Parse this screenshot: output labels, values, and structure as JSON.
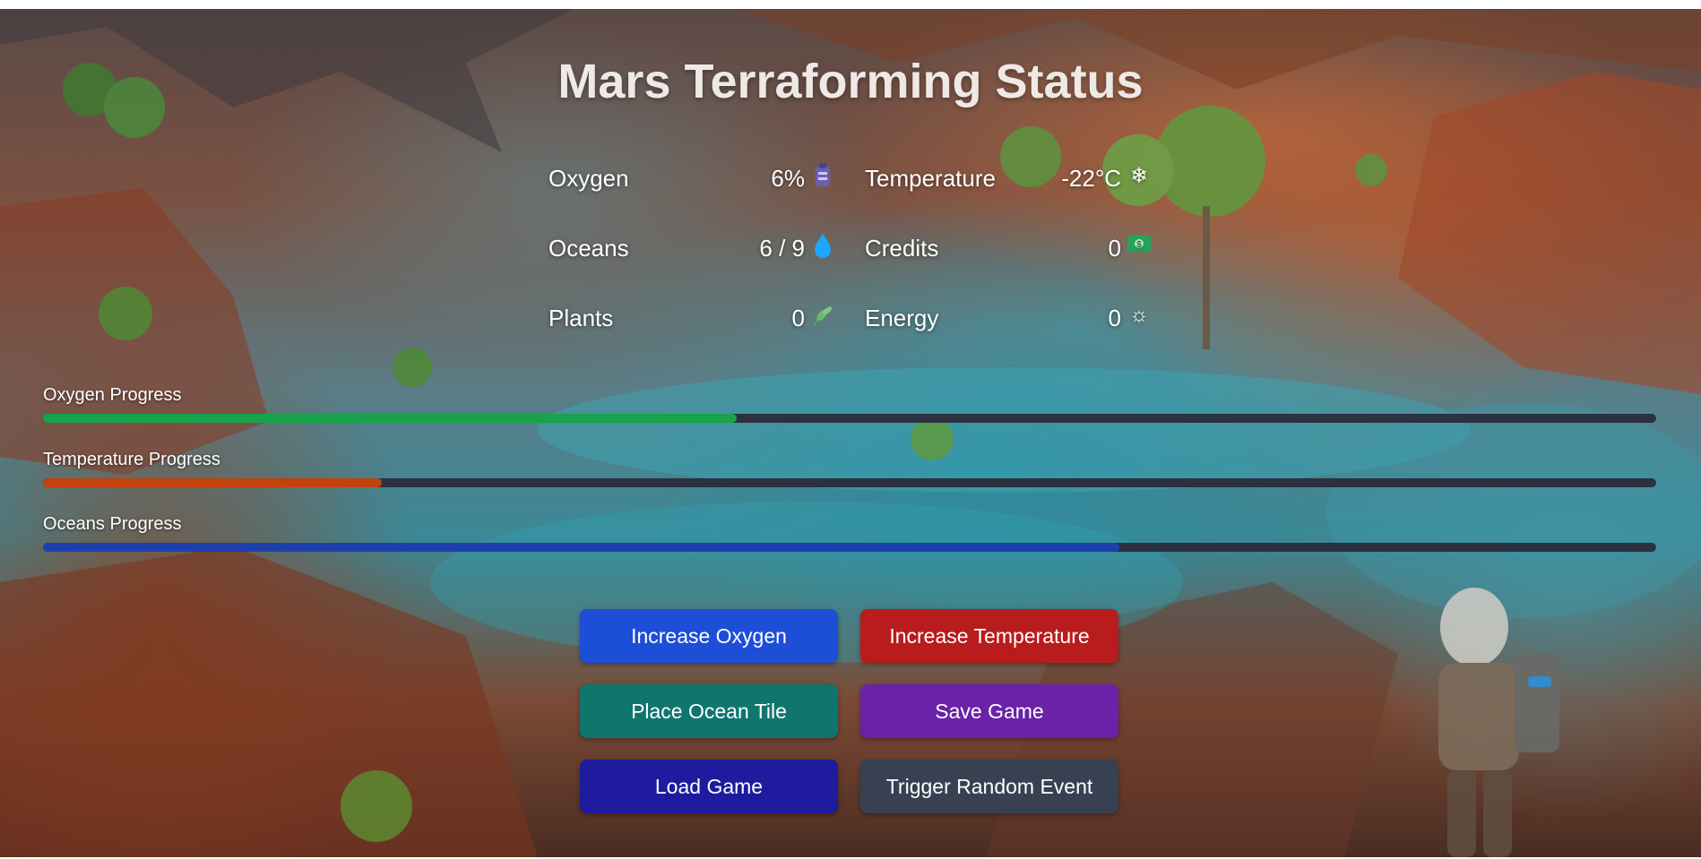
{
  "page": {
    "title": "Mars Terraforming Status"
  },
  "stats": {
    "oxygen": {
      "label": "Oxygen",
      "value": "6%",
      "icon": "oxygen-tank-icon"
    },
    "temperature": {
      "label": "Temperature",
      "value": "-22°C",
      "icon": "snowflake-icon"
    },
    "oceans": {
      "label": "Oceans",
      "value": "6 / 9",
      "icon": "water-drop-icon"
    },
    "credits": {
      "label": "Credits",
      "value": "0",
      "icon": "money-icon"
    },
    "plants": {
      "label": "Plants",
      "value": "0",
      "icon": "leaf-icon"
    },
    "energy": {
      "label": "Energy",
      "value": "0",
      "icon": "sun-icon"
    }
  },
  "progress": {
    "oxygen": {
      "label": "Oxygen Progress",
      "fraction": 0.43,
      "color": "#16a34a"
    },
    "temperature": {
      "label": "Temperature Progress",
      "fraction": 0.21,
      "color": "#c2410c"
    },
    "oceans": {
      "label": "Oceans Progress",
      "fraction": 0.667,
      "color": "#1e40af"
    }
  },
  "buttons": {
    "increase_oxygen": {
      "label": "Increase Oxygen",
      "color": "#1d4ed8"
    },
    "increase_temperature": {
      "label": "Increase Temperature",
      "color": "#b91c1c"
    },
    "place_ocean_tile": {
      "label": "Place Ocean Tile",
      "color": "#0f766e"
    },
    "save_game": {
      "label": "Save Game",
      "color": "#6b21a8"
    },
    "load_game": {
      "label": "Load Game",
      "color": "#1e1b9e"
    },
    "trigger_random_event": {
      "label": "Trigger Random Event",
      "color": "#374151"
    }
  }
}
